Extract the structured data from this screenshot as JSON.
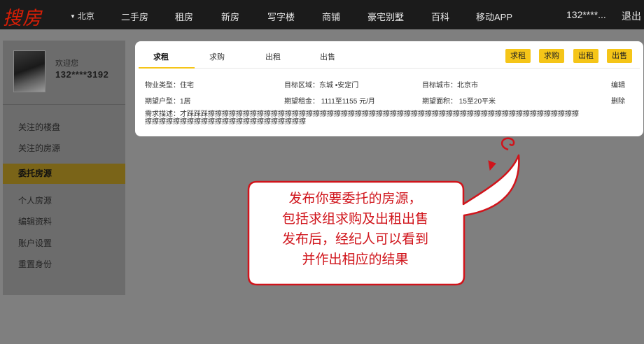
{
  "header": {
    "logo": "搜房",
    "city": "北京",
    "nav": [
      "二手房",
      "租房",
      "新房",
      "写字楼",
      "商铺",
      "豪宅别墅",
      "百科",
      "移动APP"
    ],
    "user": "132****...",
    "logout": "退出"
  },
  "sidebar": {
    "welcome": "欢迎您",
    "phone": "132****3192",
    "items": [
      {
        "label": "关注的楼盘",
        "active": false
      },
      {
        "label": "关注的房源",
        "active": false
      },
      {
        "label": "委托房源",
        "active": true
      },
      {
        "label": "个人房源",
        "active": false
      },
      {
        "label": "编辑资料",
        "active": false
      },
      {
        "label": "账户设置",
        "active": false
      },
      {
        "label": "重置身份",
        "active": false
      }
    ]
  },
  "card": {
    "tabs": [
      "求租",
      "求购",
      "出租",
      "出售"
    ],
    "active_tab": "求租",
    "buttons": [
      "求租",
      "求购",
      "出租",
      "出售"
    ],
    "fields": {
      "property_type": "物业类型：住宅",
      "target_area": "目标区域：东城 •安定门",
      "target_city": "目标城市：北京市",
      "layout": "期望户型：1居",
      "rent": "期望租金： 1111至1155 元/月",
      "size": "期望面积： 15至20平米"
    },
    "edit": "编辑",
    "delete": "删除",
    "description": "需求描述：才踩踩踩擦擦擦擦擦擦擦擦擦擦擦擦擦擦擦擦擦擦擦擦擦擦擦擦擦擦擦擦擦擦擦擦擦擦擦擦擦擦擦擦擦擦擦擦擦擦擦擦擦擦擦擦擦擦擦擦擦擦擦擦擦擦擦擦擦擦擦擦擦擦擦擦擦擦擦擦"
  },
  "callout": {
    "lines": [
      "发布你要委托的房源，",
      "包括求组求购及出租出售",
      "发布后，经纪人可以看到",
      "并作出相应的结果"
    ]
  },
  "colors": {
    "accent_yellow": "#f5c518",
    "callout_red": "#d0141b",
    "logo_red": "#d81e06"
  }
}
